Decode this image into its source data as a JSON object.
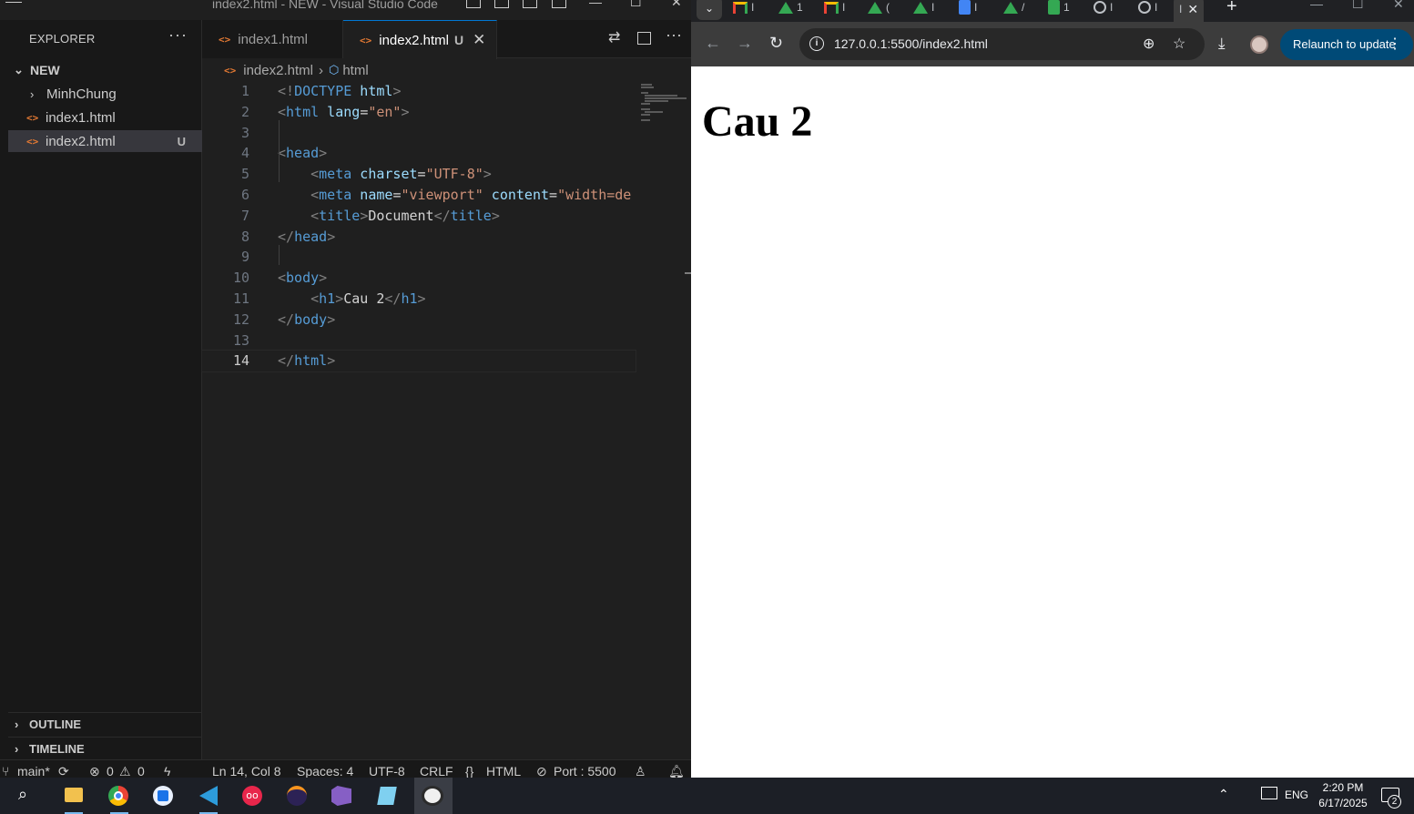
{
  "vscode": {
    "window_title": "index2.html - NEW - Visual Studio Code",
    "explorer": {
      "header": "EXPLORER",
      "more": "···",
      "folder": "NEW",
      "items": [
        {
          "label": "MinhChung",
          "type": "folder"
        },
        {
          "label": "index1.html",
          "type": "file",
          "icon": "<>"
        },
        {
          "label": "index2.html",
          "type": "file",
          "icon": "<>",
          "badge": "U",
          "selected": true
        }
      ],
      "outline": "OUTLINE",
      "timeline": "TIMELINE"
    },
    "tabs": [
      {
        "label": "index1.html",
        "active": false
      },
      {
        "label": "index2.html",
        "active": true,
        "badge": "U",
        "close": "✕"
      }
    ],
    "breadcrumb": {
      "file": "index2.html",
      "separator": "›",
      "symbol": "html"
    },
    "file_icon": "<>",
    "code_lines": [
      {
        "n": "1"
      },
      {
        "n": "2"
      },
      {
        "n": "3"
      },
      {
        "n": "4"
      },
      {
        "n": "5"
      },
      {
        "n": "6"
      },
      {
        "n": "7"
      },
      {
        "n": "8"
      },
      {
        "n": "9"
      },
      {
        "n": "10"
      },
      {
        "n": "11"
      },
      {
        "n": "12"
      },
      {
        "n": "13"
      },
      {
        "n": "14"
      }
    ],
    "code_tokens": {
      "l1": [
        "<!",
        "DOCTYPE",
        " html",
        ">"
      ],
      "l2": [
        "<",
        "html",
        " lang",
        "=",
        "\"en\"",
        ">"
      ],
      "l4": [
        "<",
        "head",
        ">"
      ],
      "l5": [
        "    ",
        "<",
        "meta",
        " charset",
        "=",
        "\"UTF-8\"",
        ">"
      ],
      "l6": [
        "    ",
        "<",
        "meta",
        " name",
        "=",
        "\"viewport\"",
        " content",
        "=",
        "\"width=de"
      ],
      "l7": [
        "    ",
        "<",
        "title",
        ">",
        "Document",
        "</",
        "title",
        ">"
      ],
      "l8": [
        "</",
        "head",
        ">"
      ],
      "l10": [
        "<",
        "body",
        ">"
      ],
      "l11": [
        "    ",
        "<",
        "h1",
        ">",
        "Cau 2",
        "</",
        "h1",
        ">"
      ],
      "l12": [
        "</",
        "body",
        ">"
      ],
      "l14": [
        "</",
        "html",
        ">"
      ]
    },
    "status": {
      "branch": "main*",
      "errors": "0",
      "warnings": "0",
      "position": "Ln 14, Col 8",
      "spaces": "Spaces: 4",
      "encoding": "UTF-8",
      "eol": "CRLF",
      "language": "HTML",
      "port": "Port : 5500"
    }
  },
  "chrome": {
    "tabs": [
      {
        "icon": "gmail-icon",
        "label": "I"
      },
      {
        "icon": "drive-icon",
        "label": "1"
      },
      {
        "icon": "gmail-icon",
        "label": "I"
      },
      {
        "icon": "drive-icon",
        "label": "("
      },
      {
        "icon": "drive-icon",
        "label": "I"
      },
      {
        "icon": "docs-icon",
        "label": "I"
      },
      {
        "icon": "drive-icon",
        "label": "/"
      },
      {
        "icon": "sheets-icon",
        "label": "1"
      },
      {
        "icon": "globe-icon",
        "label": "I"
      },
      {
        "icon": "globe-icon",
        "label": "I"
      }
    ],
    "active_tab_label": "I",
    "url": "127.0.0.1:5500/index2.html",
    "relaunch_label": "Relaunch to update",
    "page_heading": "Cau 2"
  },
  "taskbar": {
    "time": "2:20 PM",
    "date": "6/17/2025",
    "language": "ENG",
    "notifications": "2"
  },
  "colors": {
    "accent": "#0078d4",
    "tag": "#569cd6",
    "attr": "#9cdcfe",
    "string": "#ce9178",
    "file_icon": "#e37933"
  }
}
